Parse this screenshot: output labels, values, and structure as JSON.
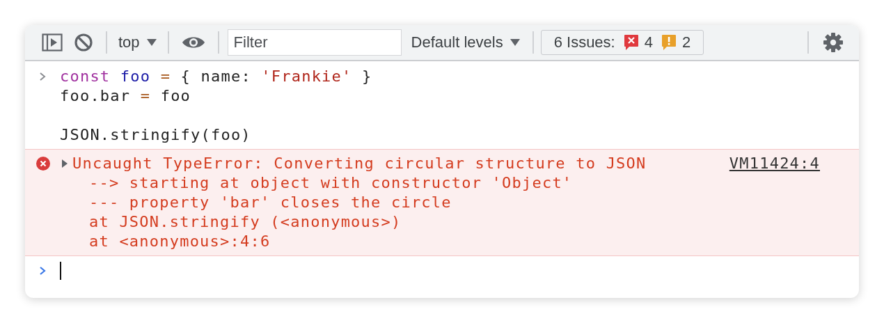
{
  "toolbar": {
    "context": "top",
    "filter": {
      "placeholder": "Filter"
    },
    "levels": "Default levels",
    "issues": {
      "label": "6 Issues:",
      "errors": "4",
      "warnings": "2"
    }
  },
  "input": {
    "blocks": [
      {
        "lines": [
          {
            "tokens": [
              {
                "text": "const",
                "kind": "keyword"
              },
              {
                "text": " foo",
                "kind": "variable"
              },
              {
                "text": " =",
                "kind": "operator"
              },
              {
                "text": " { name: ",
                "kind": "plain"
              },
              {
                "text": "'Frankie'",
                "kind": "string"
              },
              {
                "text": " }",
                "kind": "plain"
              }
            ]
          },
          {
            "tokens": [
              {
                "text": "foo.bar ",
                "kind": "plain"
              },
              {
                "text": "=",
                "kind": "operator"
              },
              {
                "text": " foo",
                "kind": "plain"
              }
            ]
          }
        ]
      },
      {
        "lines": [
          {
            "tokens": [
              {
                "text": "JSON.stringify(foo)",
                "kind": "plain"
              }
            ]
          }
        ]
      }
    ]
  },
  "error": {
    "expanded": false,
    "message": "Uncaught TypeError: Converting circular structure to JSON",
    "details": [
      "--> starting at object with constructor 'Object'",
      "--- property 'bar' closes the circle",
      "at JSON.stringify (<anonymous>)",
      "at <anonymous>:4:6"
    ],
    "source": "VM11424:4"
  }
}
